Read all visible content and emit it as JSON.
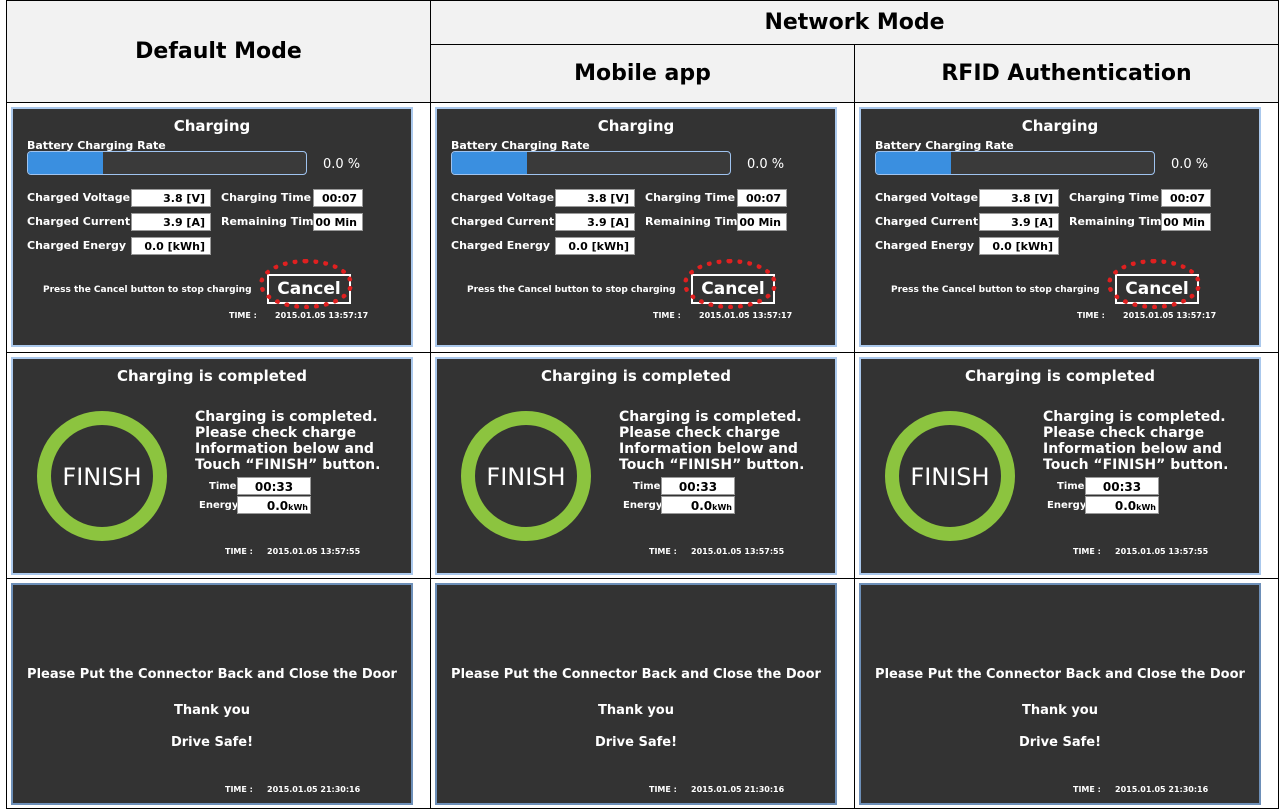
{
  "headers": {
    "default_mode": "Default Mode",
    "network_mode": "Network Mode",
    "mobile_app": "Mobile app",
    "rfid": "RFID Authentication"
  },
  "charging": {
    "title": "Charging",
    "rate_label": "Battery Charging Rate",
    "rate_percent": "0.0 %",
    "rate_fraction": 0.0,
    "voltage_label": "Charged Voltage",
    "voltage_value": "3.8 [V]",
    "current_label": "Charged Current",
    "current_value": "3.9 [A]",
    "energy_label": "Charged Energy",
    "energy_value": "0.0 [kWh]",
    "time_label": "Charging Time",
    "time_value": "00:07",
    "remaining_label": "Remaining Time",
    "remaining_value": "00 Min",
    "stop_hint": "Press the Cancel button to stop charging",
    "cancel_label": "Cancel",
    "time_prefix": "TIME :",
    "timestamp": "2015.01.05 13:57:17"
  },
  "completed": {
    "title": "Charging is completed",
    "ring_label": "FINISH",
    "message": [
      "Charging is completed.",
      "Please check charge",
      "Information below and",
      "Touch “FINISH” button."
    ],
    "time_label": "Time",
    "time_value": "00:33",
    "energy_label": "Energy",
    "energy_value": "0.0",
    "energy_unit": "kWh",
    "time_prefix": "TIME :",
    "timestamp": "2015.01.05 13:57:55"
  },
  "goodbye": {
    "line1": "Please Put the Connector Back and Close the Door",
    "line2": "Thank you",
    "line3": "Drive  Safe!",
    "time_prefix": "TIME :",
    "timestamp": "2015.01.05 21:30:16"
  },
  "colors": {
    "screen_bg": "#333333",
    "progress_blue": "#3a8fe0",
    "finish_green": "#8cc43f",
    "highlight_red": "#e02020"
  }
}
